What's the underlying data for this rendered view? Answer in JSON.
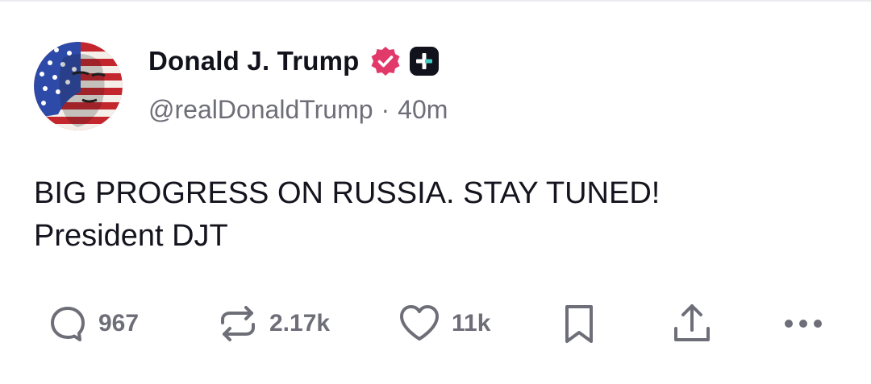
{
  "post": {
    "author_name": "Donald J. Trump",
    "handle": "@realDonaldTrump",
    "separator": "·",
    "time": "40m",
    "text_lines": [
      "BIG PROGRESS ON RUSSIA. STAY TUNED!",
      "President DJT"
    ]
  },
  "actions": {
    "replies": "967",
    "reposts": "2.17k",
    "likes": "11k"
  },
  "icons": {
    "verified": "verified-badge-icon",
    "plus": "plus-badge-icon",
    "reply": "reply-bubble-icon",
    "repost": "repost-icon",
    "like": "heart-icon",
    "bookmark": "bookmark-icon",
    "share": "share-upload-icon",
    "more": "more-dots-icon"
  },
  "colors": {
    "verified_badge": "#e2396b",
    "text": "#12121c",
    "muted": "#6e6e78",
    "plus_badge": "#12121c",
    "plus_accent": "#3fd1c6"
  }
}
